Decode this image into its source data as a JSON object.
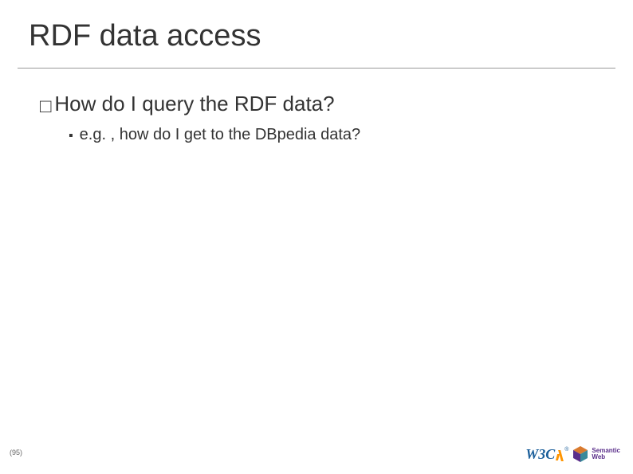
{
  "title": "RDF data access",
  "bullets": {
    "main": {
      "marker": "□",
      "text": "How do I query the RDF data?"
    },
    "sub": {
      "marker": "▪",
      "text": "e.g. , how do I get to the DBpedia data?"
    }
  },
  "footer": {
    "pageNumber": "(95)",
    "logos": {
      "w3c": {
        "text": "W3C",
        "reg": "®"
      },
      "semweb": {
        "line1": "Semantic",
        "line2": "Web"
      }
    }
  },
  "colors": {
    "titleText": "#333333",
    "bodyText": "#333333",
    "rule": "#999999",
    "w3cBlue": "#1a5e9a",
    "w3cOrange": "#ff9500",
    "semwebPurple": "#5a2e8a",
    "semwebOrange": "#d97a2e",
    "semwebTeal": "#3a8a9a"
  }
}
